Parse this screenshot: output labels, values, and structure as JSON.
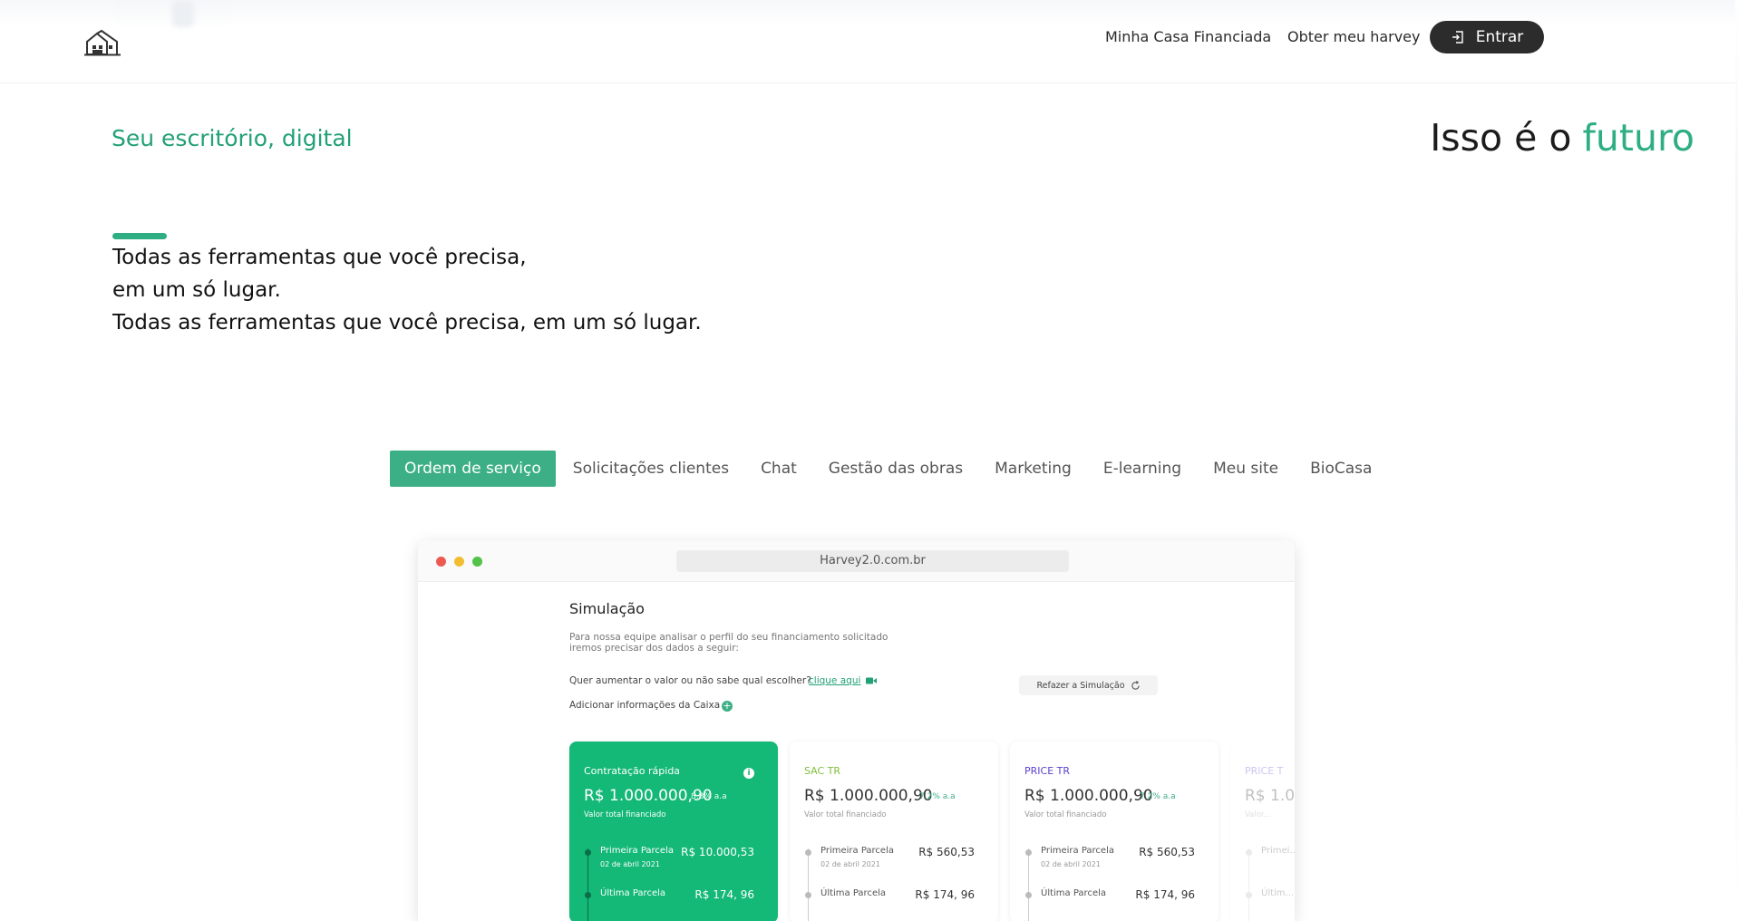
{
  "header": {
    "nav": [
      {
        "label": "Minha Casa Financiada"
      },
      {
        "label": "Obter meu harvey"
      }
    ],
    "login_label": "Entrar"
  },
  "hero": {
    "left_title": "Seu escritório, digital",
    "right_title_prefix": "Isso é o",
    "right_title_accent": "futuro",
    "lines": [
      "Todas as ferramentas que você precisa,",
      "em um só lugar.",
      "Todas as ferramentas que você precisa, em um só lugar."
    ]
  },
  "tabs": [
    {
      "label": "Ordem de serviço",
      "active": true
    },
    {
      "label": "Solicitações clientes"
    },
    {
      "label": "Chat"
    },
    {
      "label": "Gestão das obras"
    },
    {
      "label": "Marketing"
    },
    {
      "label": "E-learning"
    },
    {
      "label": "Meu site"
    },
    {
      "label": "BioCasa"
    }
  ],
  "browser": {
    "url": "Harvey2.0.com.br",
    "title": "Simulação",
    "description": "Para nossa equipe analisar o perfil do seu financiamento solicitado iremos precisar dos dados a seguir:",
    "question": "Quer aumentar o valor ou não sabe qual escolher?",
    "link": "clique aqui",
    "redo_label": "Refazer a Simulação",
    "add_info": "Adicionar informações da Caixa",
    "cards": [
      {
        "name": "Contratação rápida",
        "value": "R$ 1.000.000,90",
        "rate": "8.8% a.a",
        "value_label": "Valor total financiado",
        "first_label": "Primeira Parcela",
        "first_date": "02 de abril 2021",
        "first_value": "R$ 10.000,53",
        "last_label": "Última Parcela",
        "last_value": "R$ 174, 96"
      },
      {
        "name": "SAC TR",
        "value": "R$ 1.000.000,90",
        "rate": "7.2% a.a",
        "value_label": "Valor total financiado",
        "first_label": "Primeira Parcela",
        "first_date": "02 de abril 2021",
        "first_value": "R$ 560,53",
        "last_label": "Última Parcela",
        "last_value": "R$ 174, 96"
      },
      {
        "name": "PRICE TR",
        "value": "R$ 1.000.000,90",
        "rate": "7.2% a.a",
        "value_label": "Valor total financiado",
        "first_label": "Primeira Parcela",
        "first_date": "02 de abril 2021",
        "first_value": "R$ 560,53",
        "last_label": "Última Parcela",
        "last_value": "R$ 174, 96"
      },
      {
        "name": "PRICE T",
        "value": "R$ 1.0",
        "value_label": "Valor...",
        "first_label": "Primei...",
        "last_label": "Últim..."
      }
    ]
  },
  "colors": {
    "accent": "#2fae83",
    "card_green": "#14b877",
    "sac_color": "#7fbf3a",
    "price_color": "#5b3fd1",
    "login_bg": "#2c2c2c"
  }
}
